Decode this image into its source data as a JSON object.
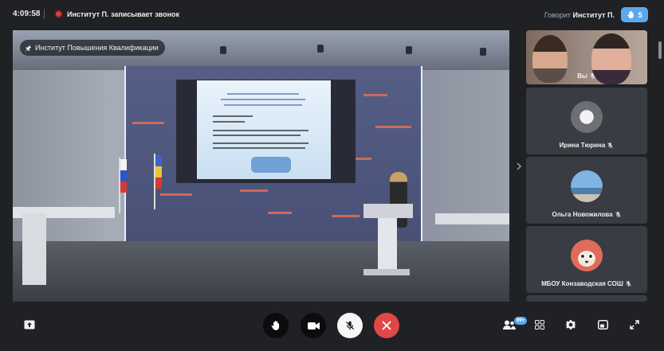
{
  "header": {
    "time": "4:09:58",
    "recording_text": "Институт П. записывает звонок",
    "speaking_label": "Говорит",
    "speaking_name": "Институт П.",
    "raised_hands_count": "5"
  },
  "main_video": {
    "conference_name": "Институт Повышения Квалификации"
  },
  "participants": [
    {
      "name": "Вы",
      "muted": true
    },
    {
      "name": "Ирина Тюрина",
      "muted": true
    },
    {
      "name": "Ольга Новожилова",
      "muted": true
    },
    {
      "name": "МБОУ Конзаводская СОШ",
      "muted": true
    }
  ],
  "toolbar": {
    "participants_badge": "99+",
    "controls": [
      "raise-hand",
      "camera",
      "microphone-muted",
      "end-call"
    ],
    "right_controls": [
      "participants",
      "grid-layout",
      "settings",
      "picture-in-picture",
      "fullscreen"
    ]
  },
  "colors": {
    "accent": "#5aa9f0",
    "end_call": "#e04848",
    "recording": "#e23b3b",
    "background": "#1f2125"
  }
}
